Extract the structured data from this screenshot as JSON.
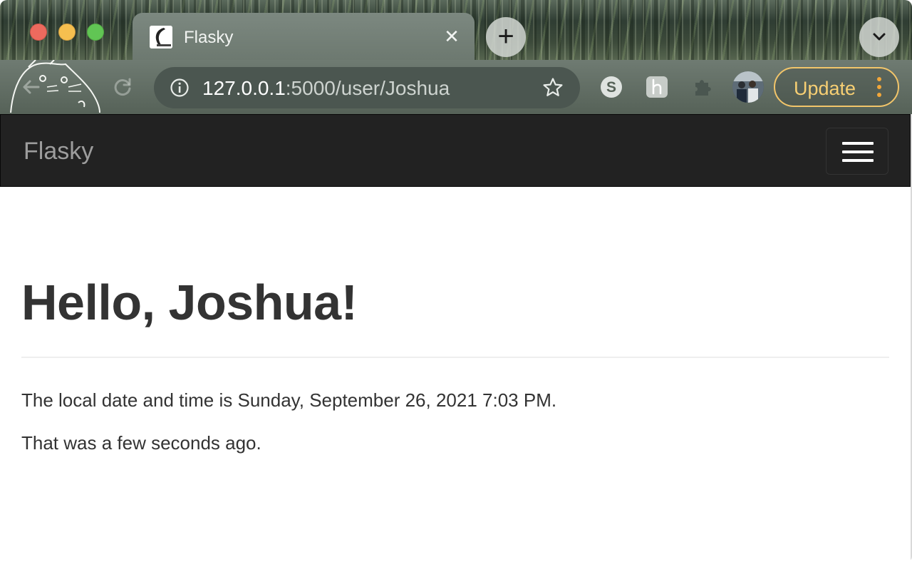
{
  "browser": {
    "tab": {
      "title": "Flasky",
      "close_glyph": "✕"
    },
    "new_tab_glyph": "+",
    "omnibox": {
      "url_host": "127.0.0.1",
      "url_rest": ":5000/user/Joshua"
    },
    "update_button": {
      "label": "Update"
    },
    "icons": {
      "back": "back-arrow-icon",
      "reload": "reload-icon",
      "site_info": "info-icon",
      "bookmark": "star-icon",
      "extension_1": "skype-extension-icon",
      "extension_2": "honey-extension-icon",
      "extensions_menu": "puzzle-icon"
    }
  },
  "navbar": {
    "brand": "Flasky"
  },
  "page": {
    "title": "Hello, Joshua!",
    "local_time_line": "The local date and time is Sunday, September 26, 2021 7:03 PM.",
    "relative_time_line": "That was a few seconds ago."
  },
  "colors": {
    "navbar_bg": "#222222",
    "brand_text": "#9d9d9d",
    "body_text": "#333333",
    "update_accent": "#f7cf73",
    "update_dots": "#f2a73a"
  }
}
